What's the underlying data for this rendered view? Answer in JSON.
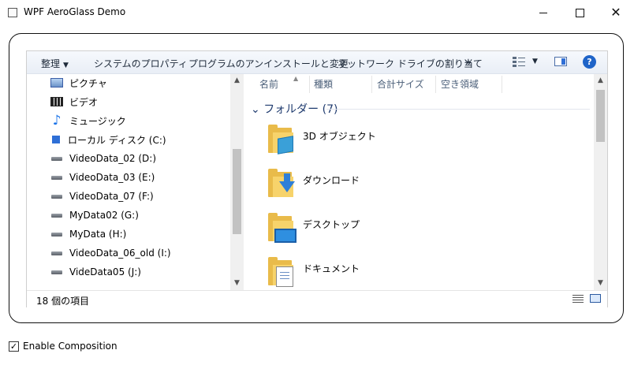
{
  "window": {
    "title": "WPF AeroGlass Demo",
    "minimize_glyph": "",
    "maximize_glyph": "",
    "close_glyph": "✕"
  },
  "commandbar": {
    "organize": "整理",
    "system_properties": "システムのプロパティ",
    "uninstall": "プログラムのアンインストールと変更",
    "map_network_drive": "ネットワーク ドライブの割り当て",
    "more": "»",
    "help": "?"
  },
  "nav": {
    "items": [
      {
        "label": "ピクチャ",
        "icon": "pictures-icon"
      },
      {
        "label": "ビデオ",
        "icon": "videos-icon"
      },
      {
        "label": "ミュージック",
        "icon": "music-icon"
      },
      {
        "label": "ローカル ディスク (C:)",
        "icon": "local-disk-icon"
      },
      {
        "label": "VideoData_02 (D:)",
        "icon": "drive-icon"
      },
      {
        "label": "VideoData_03 (E:)",
        "icon": "drive-icon"
      },
      {
        "label": "VideoData_07 (F:)",
        "icon": "drive-icon"
      },
      {
        "label": "MyData02 (G:)",
        "icon": "drive-icon"
      },
      {
        "label": "MyData (H:)",
        "icon": "drive-icon"
      },
      {
        "label": "VideoData_06_old (I:)",
        "icon": "drive-icon"
      },
      {
        "label": "VideData05 (J:)",
        "icon": "drive-icon"
      }
    ]
  },
  "content": {
    "columns": [
      "名前",
      "種類",
      "合計サイズ",
      "空き領域"
    ],
    "group_header": "フォルダー (7)",
    "folders": [
      {
        "label": "3D オブジェクト",
        "icon": "3d-objects-folder-icon"
      },
      {
        "label": "ダウンロード",
        "icon": "downloads-folder-icon"
      },
      {
        "label": "デスクトップ",
        "icon": "desktop-folder-icon"
      },
      {
        "label": "ドキュメント",
        "icon": "documents-folder-icon"
      }
    ]
  },
  "statusbar": {
    "item_count": "18 個の項目"
  },
  "options": {
    "enable_composition_label": "Enable Composition",
    "enable_composition_checked": true,
    "check_glyph": "✓"
  }
}
